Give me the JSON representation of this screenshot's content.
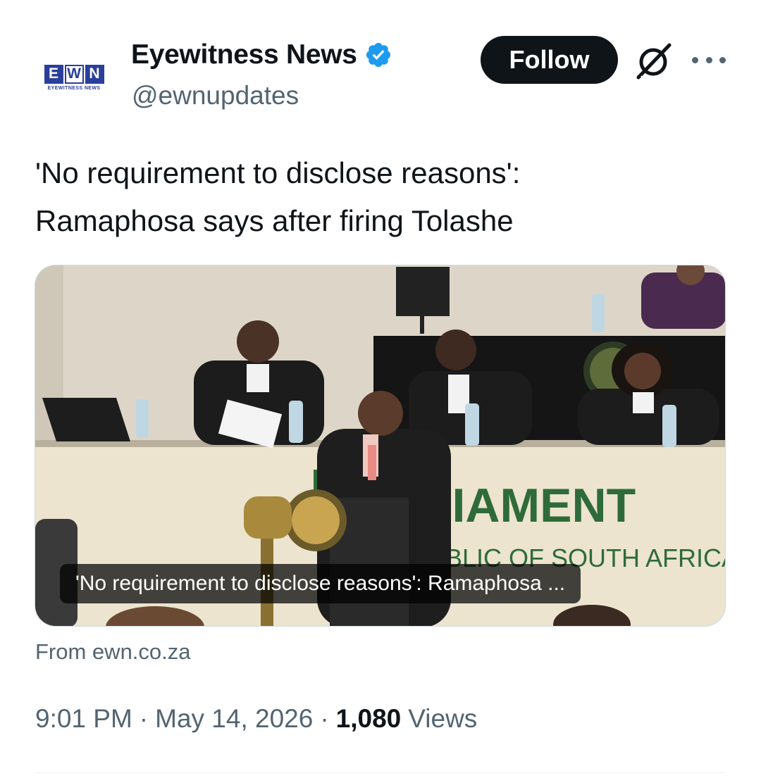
{
  "author": {
    "avatar_top": "EWN",
    "avatar_letters": [
      "E",
      "W",
      "N"
    ],
    "avatar_sub": "EYEWITNESS NEWS",
    "display_name": "Eyewitness News",
    "handle": "@ewnupdates",
    "verified": true,
    "verified_color": "#1d9bf0"
  },
  "actions": {
    "follow_label": "Follow",
    "grok_icon": "grok-icon",
    "more_icon": "more-icon"
  },
  "tweet": {
    "text_line1": "'No requirement to disclose reasons':",
    "text_line2": "Ramaphosa says after firing Tolashe"
  },
  "card": {
    "image_description_icon": "parliament-photo",
    "banner_text": "LIAMENT",
    "banner_subtext": "IBLIC OF SOUTH AFRICA",
    "caption": "'No requirement to disclose reasons': Ramaphosa ...",
    "source": "From ewn.co.za"
  },
  "meta": {
    "time": "9:01 PM",
    "separator": "·",
    "date": "May 14, 2026",
    "views_count": "1,080",
    "views_label": "Views"
  },
  "colors": {
    "text_primary": "#0f1419",
    "text_secondary": "#536471",
    "follow_bg": "#0f1419",
    "ewn_blue": "#2a3f9c",
    "banner_green": "#2f6b3a"
  }
}
